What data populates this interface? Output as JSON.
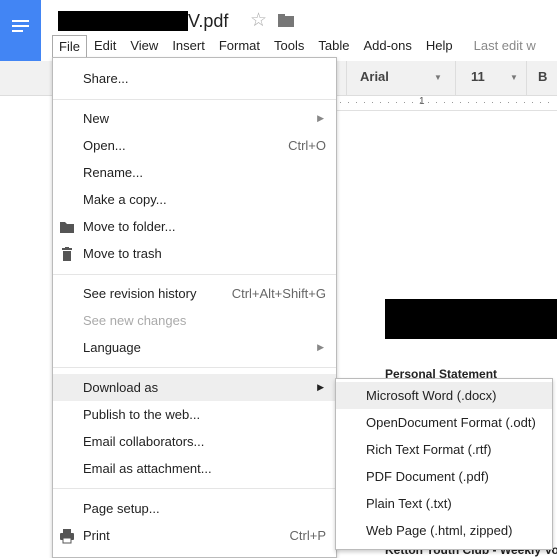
{
  "doc": {
    "title_suffix": "V.pdf",
    "body_line_1": "Personal Statement",
    "body_line_2": "Ketton Youth Club - Weekly Vol"
  },
  "menubar": {
    "items": [
      "File",
      "Edit",
      "View",
      "Insert",
      "Format",
      "Tools",
      "Table",
      "Add-ons",
      "Help"
    ],
    "last_edit": "Last edit w"
  },
  "toolbar": {
    "font": "Arial",
    "size": "11",
    "bold": "B"
  },
  "ruler": {
    "mark": "1"
  },
  "file_menu": {
    "share": "Share...",
    "new": "New",
    "open": "Open...",
    "open_sc": "Ctrl+O",
    "rename": "Rename...",
    "copy": "Make a copy...",
    "move_folder": "Move to folder...",
    "move_trash": "Move to trash",
    "revision": "See revision history",
    "revision_sc": "Ctrl+Alt+Shift+G",
    "new_changes": "See new changes",
    "language": "Language",
    "download": "Download as",
    "publish": "Publish to the web...",
    "email_collab": "Email collaborators...",
    "email_attach": "Email as attachment...",
    "page_setup": "Page setup...",
    "print": "Print",
    "print_sc": "Ctrl+P"
  },
  "download_submenu": [
    "Microsoft Word (.docx)",
    "OpenDocument Format (.odt)",
    "Rich Text Format (.rtf)",
    "PDF Document (.pdf)",
    "Plain Text (.txt)",
    "Web Page (.html, zipped)"
  ],
  "colors": {
    "accent": "#4285f4",
    "highlight": "#eeeeee"
  }
}
